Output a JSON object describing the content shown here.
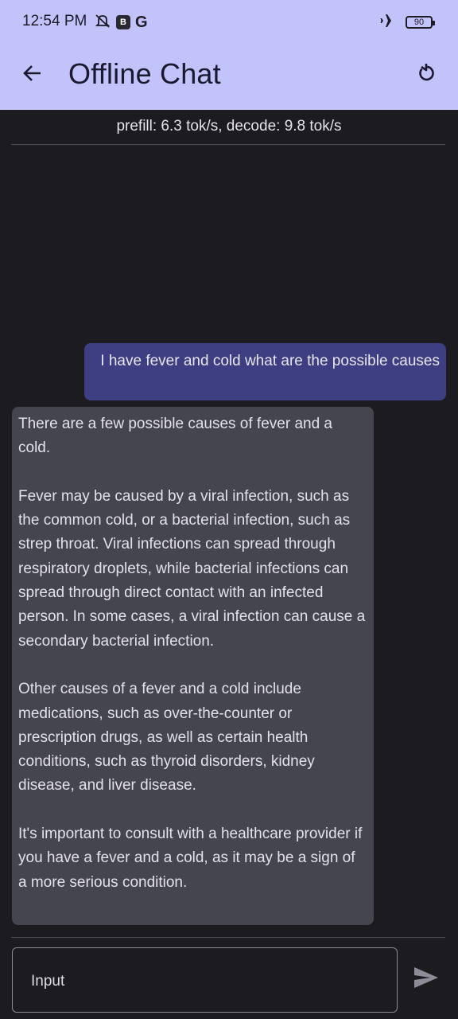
{
  "status_bar": {
    "time": "12:54 PM",
    "badge": "B",
    "g_icon": "G",
    "battery": "90",
    "icons": [
      "silent-icon",
      "airplane-icon",
      "battery-icon"
    ]
  },
  "toolbar": {
    "title": "Offline Chat",
    "back_icon": "arrow-back-icon",
    "refresh_icon": "refresh-icon"
  },
  "stats": "prefill: 6.3 tok/s, decode: 9.8 tok/s",
  "messages": [
    {
      "role": "user",
      "text": "I have fever and cold what are the possible causes"
    },
    {
      "role": "assistant",
      "text": "There are a few possible causes of fever and a cold.\n\nFever may be caused by a viral infection, such as the common cold, or a bacterial infection, such as strep throat. Viral infections can spread through respiratory droplets, while bacterial infections can spread through direct contact with an infected person. In some cases, a viral infection can cause a secondary bacterial infection.\n\nOther causes of a fever and a cold include medications, such as over-the-counter or prescription drugs, as well as certain health conditions, such as thyroid disorders, kidney disease, and liver disease.\n\nIt's important to consult with a healthcare provider if you have a fever and a cold, as it may be a sign of a more serious condition."
    }
  ],
  "input": {
    "label": "Input",
    "send_icon": "send-icon"
  },
  "colors": {
    "header": "#c3c3fb",
    "background": "#1c1b20",
    "user_bubble": "#3d3f82",
    "assistant_bubble": "#44454f"
  }
}
